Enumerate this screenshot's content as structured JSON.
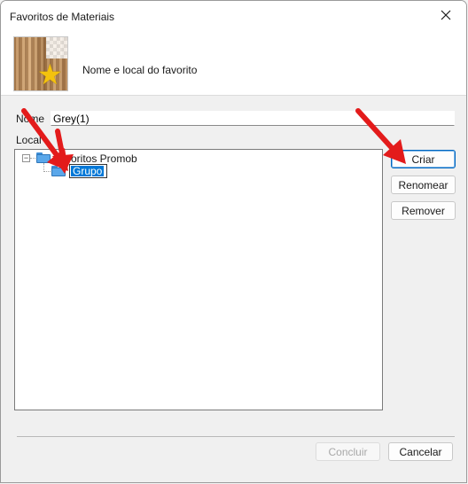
{
  "window": {
    "title": "Favoritos de Materiais"
  },
  "header": {
    "description": "Nome e local do favorito"
  },
  "form": {
    "name_label": "Nome",
    "name_value": "Grey(1)",
    "location_label": "Local"
  },
  "tree": {
    "root_label": "Favoritos Promob",
    "root_expander": "−",
    "child_label": "Grupo"
  },
  "buttons": {
    "create": "Criar",
    "rename": "Renomear",
    "remove": "Remover",
    "finish": "Concluir",
    "cancel": "Cancelar"
  },
  "icons": {
    "close": "close-icon",
    "thumbnail_badge": "star-icon",
    "folder": "folder-icon",
    "annotation": "red-arrow-icon"
  },
  "colors": {
    "annotation_arrow": "#e31b1b",
    "selection": "#0078d7",
    "primary_border": "#0067c0"
  }
}
